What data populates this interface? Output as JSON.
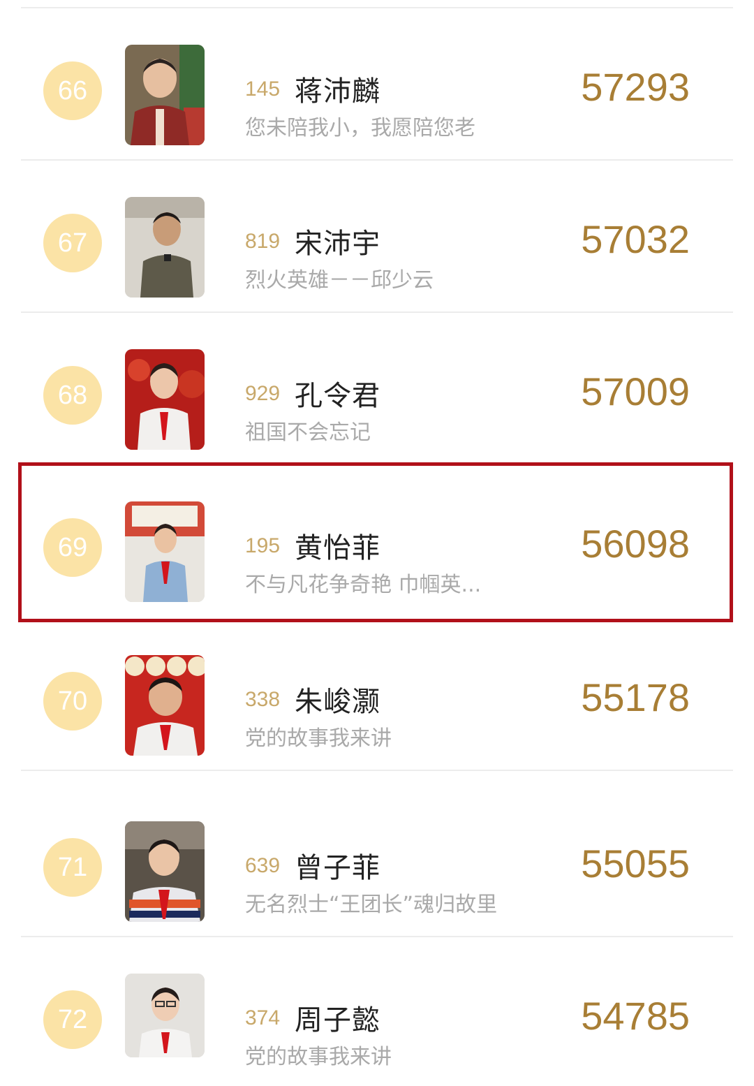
{
  "leaderboard": {
    "rows": [
      {
        "rank": "66",
        "number": "145",
        "name": "蒋沛麟",
        "subtitle": "您未陪我小，我愿陪您老",
        "score": "57293"
      },
      {
        "rank": "67",
        "number": "819",
        "name": "宋沛宇",
        "subtitle": "烈火英雄－－邱少云",
        "score": "57032"
      },
      {
        "rank": "68",
        "number": "929",
        "name": "孔令君",
        "subtitle": "祖国不会忘记",
        "score": "57009"
      },
      {
        "rank": "69",
        "number": "195",
        "name": "黄怡菲",
        "subtitle": "不与凡花争奇艳 巾帼英...",
        "score": "56098"
      },
      {
        "rank": "70",
        "number": "338",
        "name": "朱峻灏",
        "subtitle": "党的故事我来讲",
        "score": "55178"
      },
      {
        "rank": "71",
        "number": "639",
        "name": "曾子菲",
        "subtitle": "无名烈士“王团长”魂归故里",
        "score": "55055"
      },
      {
        "rank": "72",
        "number": "374",
        "name": "周子懿",
        "subtitle": "党的故事我来讲",
        "score": "54785"
      }
    ],
    "highlighted_rank": "69"
  },
  "colors": {
    "badge": "#fbe3a6",
    "number": "#c8a86a",
    "score": "#a87e35",
    "subtitle": "#a9a9a9",
    "highlight_border": "#b1101a"
  }
}
